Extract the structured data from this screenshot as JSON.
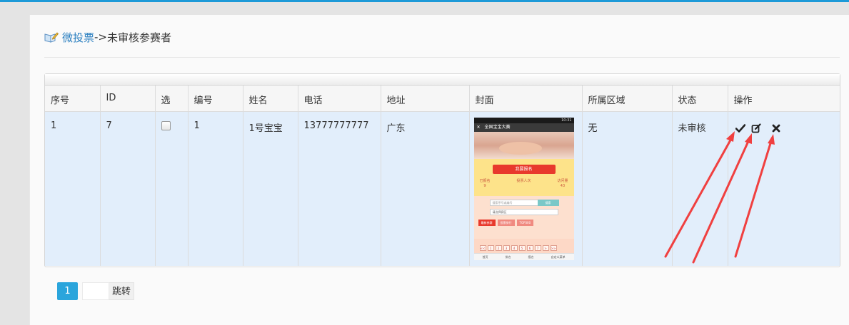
{
  "breadcrumb": {
    "link": "微投票",
    "sep": "->",
    "current": "未审核参赛者"
  },
  "table": {
    "headers": [
      "序号",
      "ID",
      "选",
      "编号",
      "姓名",
      "电话",
      "地址",
      "封面",
      "所属区域",
      "状态",
      "操作"
    ],
    "rows": [
      {
        "seq": "1",
        "id": "7",
        "num": "1",
        "name": "1号宝宝",
        "phone": "13777777777",
        "address": "广东",
        "region": "无",
        "status": "未审核"
      }
    ]
  },
  "thumbnail": {
    "app_title": "全国宝宝大赛",
    "status_time": "10:31",
    "signup_button": "我要报名",
    "stats": [
      {
        "label": "已报名",
        "value": "9"
      },
      {
        "label": "投票人次",
        "value": ""
      },
      {
        "label": "访问量",
        "value": "43"
      }
    ],
    "search_placeholder": "搜索序号或编号",
    "search_button": "搜索",
    "select_text": "请选择赛区",
    "tabs": [
      "最新参赛",
      "投票排行",
      "TOP300"
    ],
    "pager": [
      "<<",
      "1",
      "2",
      "3",
      "4",
      "5",
      "6",
      "7",
      ">",
      ">>"
    ],
    "nav": [
      "首页",
      "排名",
      "报名",
      "自定义菜单"
    ]
  },
  "actions": {
    "approve_icon": "check-icon",
    "edit_icon": "edit-icon",
    "delete_icon": "close-icon"
  },
  "pagination": {
    "current_page": "1",
    "jump_input_value": "",
    "jump_label": "跳转"
  },
  "colors": {
    "accent": "#2aa5dc",
    "row_bg": "#e2eefb",
    "arrow": "#f04040",
    "link": "#2a7fc0"
  }
}
